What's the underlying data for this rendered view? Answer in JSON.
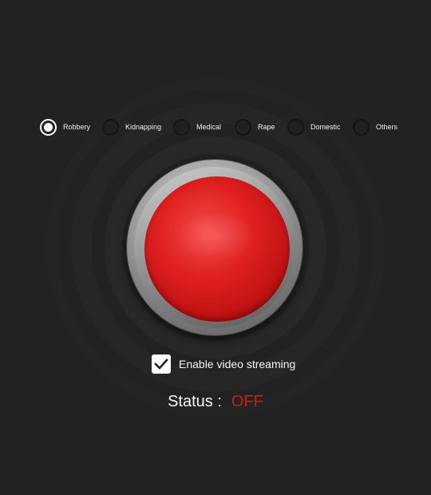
{
  "categories": {
    "selected_index": 0,
    "items": [
      {
        "label": "Robbery",
        "checked": true
      },
      {
        "label": "Kidnapping",
        "checked": false
      },
      {
        "label": "Medical",
        "checked": false
      },
      {
        "label": "Rape",
        "checked": false
      },
      {
        "label": "Domestic",
        "checked": false
      },
      {
        "label": "Others",
        "checked": false
      }
    ]
  },
  "panic_button": {
    "color": "#e02020"
  },
  "video_streaming": {
    "label": "Enable video streaming",
    "checked": true
  },
  "status": {
    "label": "Status :",
    "value": "OFF",
    "value_color": "#d11c1c"
  },
  "theme": {
    "background": "#222222",
    "text": "#ffffff"
  }
}
